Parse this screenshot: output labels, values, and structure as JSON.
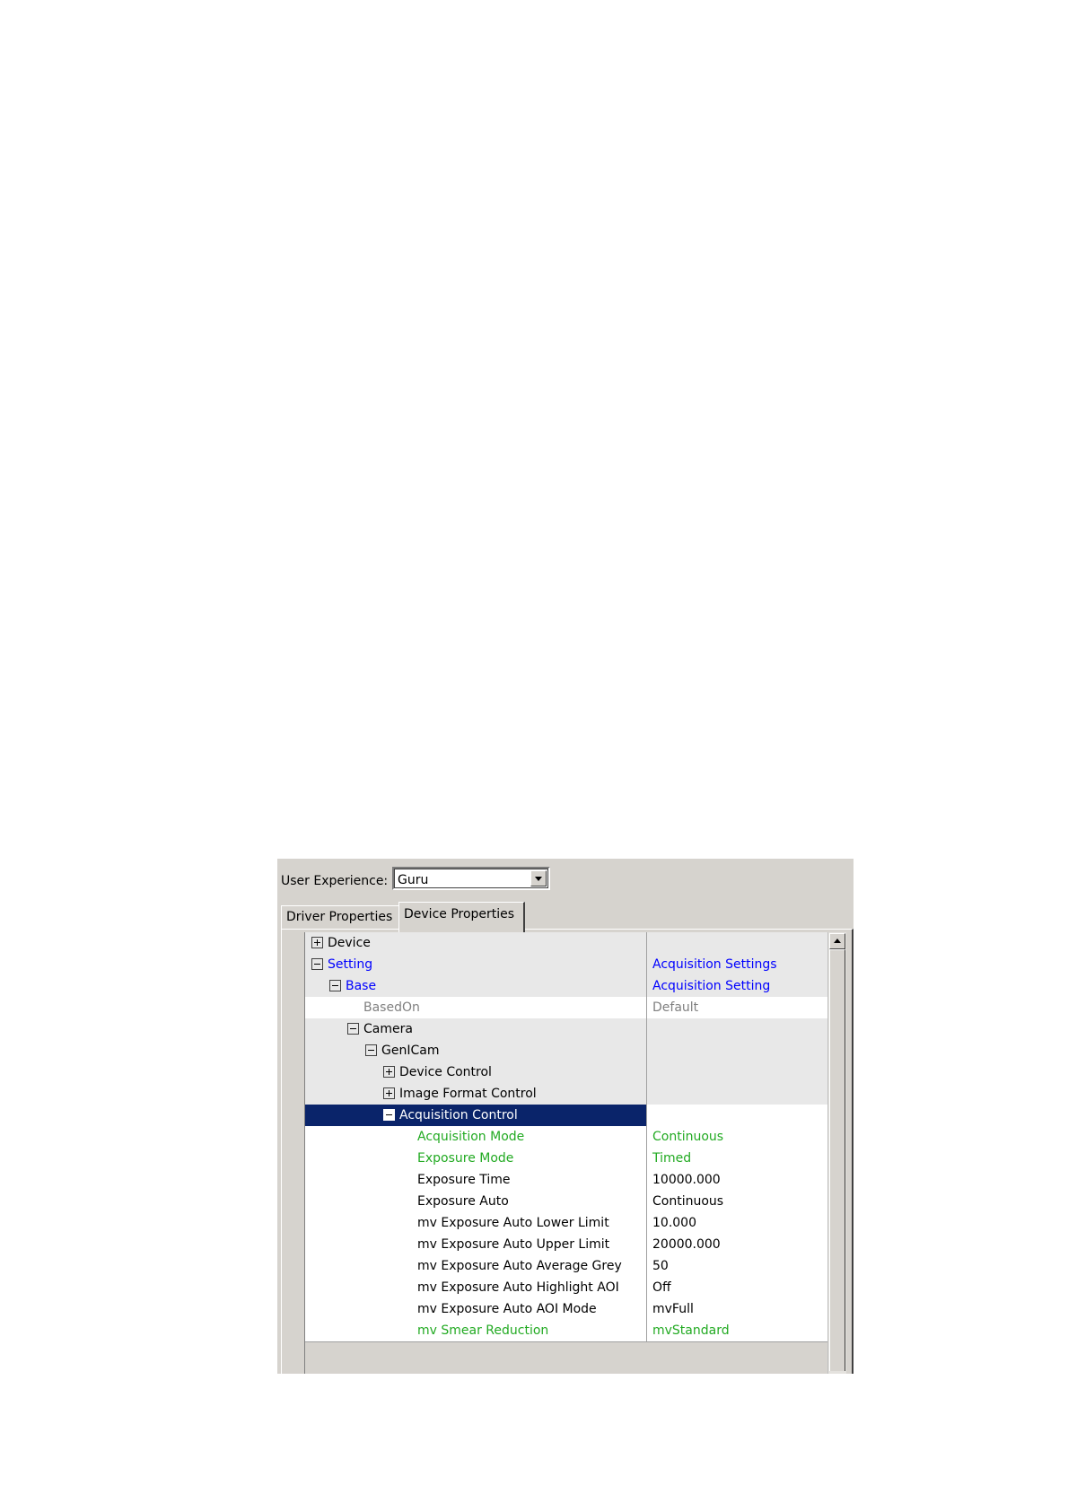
{
  "user_experience": {
    "label": "User Experience:",
    "selected": "Guru"
  },
  "tabs": [
    {
      "label": "Driver Properties",
      "active": false
    },
    {
      "label": "Device Properties",
      "active": true
    }
  ],
  "colors": {
    "selection": "#0a246a",
    "link_blue": "#0000ff",
    "read_only_gray": "#808080",
    "modified_green": "#22aa22",
    "group_background": "#e8e8e8"
  },
  "tree": [
    {
      "name": "Device",
      "value": "",
      "depth": 0,
      "expander": "plus",
      "color": "black",
      "kind": "group"
    },
    {
      "name": "Setting",
      "value": "Acquisition Settings",
      "depth": 0,
      "expander": "minus",
      "color": "blue",
      "kind": "group"
    },
    {
      "name": "Base",
      "value": "Acquisition Setting",
      "depth": 1,
      "expander": "minus",
      "color": "blue",
      "kind": "group"
    },
    {
      "name": "BasedOn",
      "value": "Default",
      "depth": 2,
      "expander": "none",
      "color": "gray",
      "kind": "leaf"
    },
    {
      "name": "Camera",
      "value": "",
      "depth": 2,
      "expander": "minus",
      "color": "black",
      "kind": "group"
    },
    {
      "name": "GenICam",
      "value": "",
      "depth": 3,
      "expander": "minus",
      "color": "black",
      "kind": "group"
    },
    {
      "name": "Device Control",
      "value": "",
      "depth": 4,
      "expander": "plus",
      "color": "black",
      "kind": "group"
    },
    {
      "name": "Image Format Control",
      "value": "",
      "depth": 4,
      "expander": "plus",
      "color": "black",
      "kind": "group"
    },
    {
      "name": "Acquisition Control",
      "value": "",
      "depth": 4,
      "expander": "minus",
      "color": "black",
      "kind": "group",
      "selected": true
    },
    {
      "name": "Acquisition Mode",
      "value": "Continuous",
      "depth": 5,
      "expander": "none",
      "color": "green",
      "kind": "leaf"
    },
    {
      "name": "Exposure Mode",
      "value": "Timed",
      "depth": 5,
      "expander": "none",
      "color": "green",
      "kind": "leaf"
    },
    {
      "name": "Exposure Time",
      "value": "10000.000",
      "depth": 5,
      "expander": "none",
      "color": "black",
      "kind": "leaf"
    },
    {
      "name": "Exposure Auto",
      "value": "Continuous",
      "depth": 5,
      "expander": "none",
      "color": "black",
      "kind": "leaf"
    },
    {
      "name": "mv Exposure Auto Lower Limit",
      "value": "10.000",
      "depth": 5,
      "expander": "none",
      "color": "black",
      "kind": "leaf"
    },
    {
      "name": "mv Exposure Auto Upper Limit",
      "value": "20000.000",
      "depth": 5,
      "expander": "none",
      "color": "black",
      "kind": "leaf"
    },
    {
      "name": "mv Exposure Auto Average Grey",
      "value": "50",
      "depth": 5,
      "expander": "none",
      "color": "black",
      "kind": "leaf"
    },
    {
      "name": "mv Exposure Auto Highlight AOI",
      "value": "Off",
      "depth": 5,
      "expander": "none",
      "color": "black",
      "kind": "leaf"
    },
    {
      "name": "mv Exposure Auto AOI Mode",
      "value": "mvFull",
      "depth": 5,
      "expander": "none",
      "color": "black",
      "kind": "leaf"
    },
    {
      "name": "mv Smear Reduction",
      "value": "mvStandard",
      "depth": 5,
      "expander": "none",
      "color": "green",
      "kind": "leaf"
    }
  ]
}
